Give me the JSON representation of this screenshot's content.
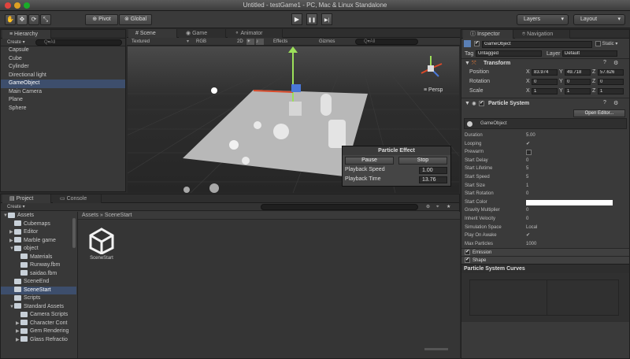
{
  "window": {
    "title": "Untitled - testGame1 - PC, Mac & Linux Standalone"
  },
  "toolbar": {
    "pivot": "Pivot",
    "global": "Global",
    "layers": "Layers",
    "layout": "Layout",
    "play": "▶",
    "pause": "❚❚",
    "step": "▶|"
  },
  "hierarchy": {
    "tab": "Hierarchy",
    "create": "Create ▾",
    "search": "Q▾All",
    "items": [
      "Capsule",
      "Cube",
      "Cylinder",
      "Directional light",
      "GameObject",
      "Main Camera",
      "Plane",
      "Sphere"
    ],
    "selected_index": 4
  },
  "scene": {
    "tabs": [
      "Scene",
      "Game",
      "Animator"
    ],
    "shading": "Textured",
    "rgb": "RGB",
    "mode_2d": "2D",
    "effects": "Effects",
    "gizmos": "Gizmos",
    "search": "Q▾All",
    "persp": "Persp"
  },
  "particle_effect": {
    "title": "Particle Effect",
    "pause": "Pause",
    "stop": "Stop",
    "playback_speed_label": "Playback Speed",
    "playback_speed": "1.00",
    "playback_time_label": "Playback Time",
    "playback_time": "13.76"
  },
  "project": {
    "tabs": [
      "Project",
      "Console"
    ],
    "create": "Create ▾",
    "breadcrumb_root": "Assets",
    "breadcrumb_sep": "»",
    "breadcrumb_current": "SceneStart",
    "asset_label": "SceneStart",
    "tree": [
      {
        "label": "Assets",
        "depth": 0,
        "arrow": "▼"
      },
      {
        "label": "Cubemaps",
        "depth": 1,
        "arrow": ""
      },
      {
        "label": "Editor",
        "depth": 1,
        "arrow": "▶"
      },
      {
        "label": "Marble game",
        "depth": 1,
        "arrow": "▶"
      },
      {
        "label": "object",
        "depth": 1,
        "arrow": "▼"
      },
      {
        "label": "Materials",
        "depth": 2,
        "arrow": ""
      },
      {
        "label": "Runway.fbm",
        "depth": 2,
        "arrow": ""
      },
      {
        "label": "saidao.fbm",
        "depth": 2,
        "arrow": ""
      },
      {
        "label": "SceneEnd",
        "depth": 1,
        "arrow": ""
      },
      {
        "label": "SceneStart",
        "depth": 1,
        "arrow": ""
      },
      {
        "label": "Scripts",
        "depth": 1,
        "arrow": ""
      },
      {
        "label": "Standard Assets",
        "depth": 1,
        "arrow": "▼"
      },
      {
        "label": "Camera Scripts",
        "depth": 2,
        "arrow": ""
      },
      {
        "label": "Character Cont",
        "depth": 2,
        "arrow": "▶"
      },
      {
        "label": "Gem Rendering",
        "depth": 2,
        "arrow": "▶"
      },
      {
        "label": "Glass Refractio",
        "depth": 2,
        "arrow": "▶"
      }
    ],
    "selected_index": 9
  },
  "inspector": {
    "tabs": [
      "Inspector",
      "Navigation"
    ],
    "object_name": "GameObject",
    "static": "Static ▾",
    "tag_label": "Tag",
    "tag_value": "Untagged",
    "layer_label": "Layer",
    "layer_value": "Default",
    "transform_title": "Transform",
    "position_label": "Position",
    "rotation_label": "Rotation",
    "scale_label": "Scale",
    "position": {
      "x": "83.974",
      "y": "49.718",
      "z": "57.626"
    },
    "rotation": {
      "x": "0",
      "y": "0",
      "z": "0"
    },
    "scale": {
      "x": "1",
      "y": "1",
      "z": "1"
    },
    "ps_title": "Particle System",
    "open_editor": "Open Editor...",
    "ps_object": "GameObject",
    "ps_rows": [
      {
        "label": "Duration",
        "value": "5.00"
      },
      {
        "label": "Looping",
        "value": "✔"
      },
      {
        "label": "Prewarm",
        "value": ""
      },
      {
        "label": "Start Delay",
        "value": "0"
      },
      {
        "label": "Start Lifetime",
        "value": "5"
      },
      {
        "label": "Start Speed",
        "value": "5"
      },
      {
        "label": "Start Size",
        "value": "1"
      },
      {
        "label": "Start Rotation",
        "value": "0"
      },
      {
        "label": "Start Color",
        "value": ""
      },
      {
        "label": "Gravity Multiplier",
        "value": "0"
      },
      {
        "label": "Inherit Velocity",
        "value": "0"
      },
      {
        "label": "Simulation Space",
        "value": "Local"
      },
      {
        "label": "Play On Awake",
        "value": "✔"
      },
      {
        "label": "Max Particles",
        "value": "1000"
      }
    ],
    "modules": [
      "Emission",
      "Shape"
    ],
    "curves_title": "Particle System Curves"
  }
}
